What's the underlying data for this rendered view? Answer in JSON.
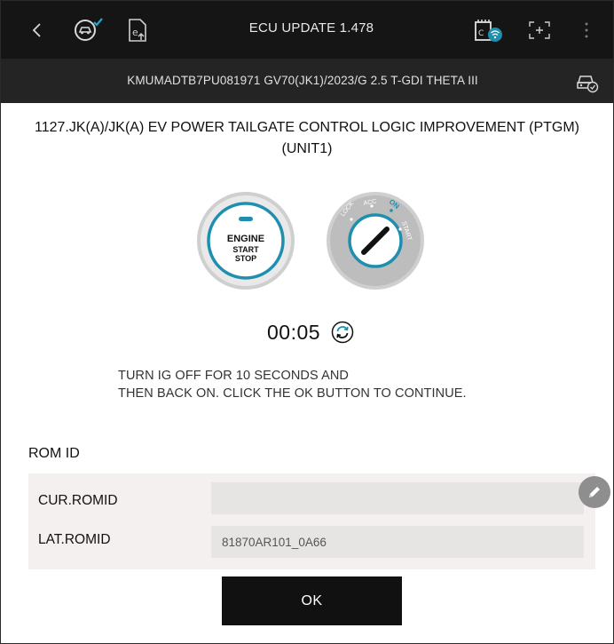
{
  "toolbar": {
    "title": "ECU UPDATE 1.478",
    "back_icon": "chevron-left-icon",
    "diagnosis_icon": "vehicle-diagnosis-icon",
    "report_icon": "report-upload-icon",
    "vci_icon": "vci-wireless-icon",
    "capture_icon": "screen-capture-icon",
    "menu_icon": "more-vertical-icon"
  },
  "vehicle": {
    "info": "KMUMADTB7PU081971  GV70(JK1)/2023/G 2.5 T-GDI THETA III",
    "icon": "car-connection-icon"
  },
  "procedure": {
    "title_line1": "1127.JK(A)/JK(A) EV POWER TAILGATE CONTROL LOGIC IMPROVEMENT (PTGM)",
    "title_line2": "(UNIT1)",
    "timer": "00:05",
    "instruction_line1": "TURN IG OFF FOR 10 SECONDS AND",
    "instruction_line2": "THEN BACK ON. CLICK THE OK BUTTON TO CONTINUE."
  },
  "engine_button": {
    "line1": "ENGINE",
    "line2": "START",
    "line3": "STOP"
  },
  "ignition": {
    "lock": "LOCK",
    "acc": "ACC",
    "on": "ON",
    "start": "START"
  },
  "rom": {
    "title": "ROM ID",
    "cur_label": "CUR.ROMID",
    "cur_value": "",
    "lat_label": "LAT.ROMID",
    "lat_value": "81870AR101_0A66"
  },
  "ok_label": "OK",
  "colors": {
    "accent": "#1f8fb0",
    "toolbar_bg": "#151515",
    "infobar_bg": "#242424",
    "panel_bg": "#f3f0ef"
  }
}
